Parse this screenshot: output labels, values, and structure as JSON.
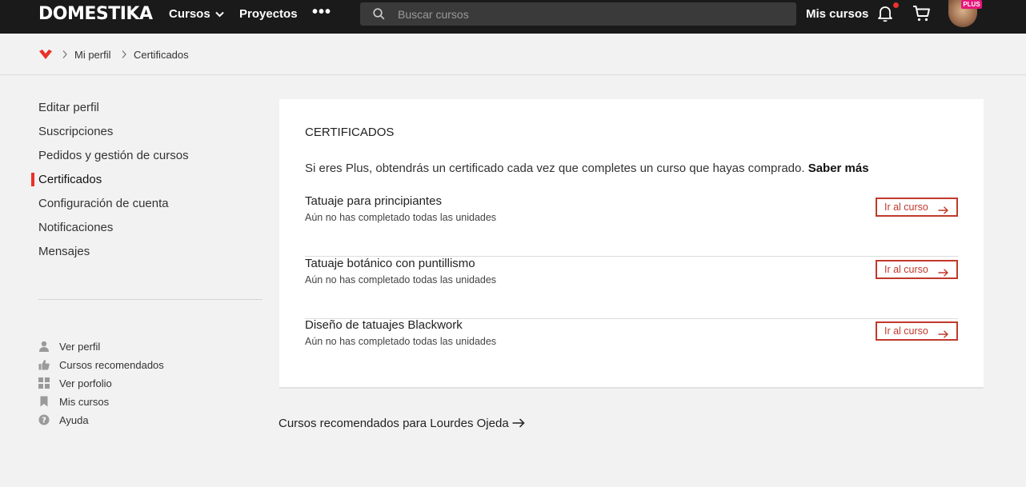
{
  "header": {
    "logo": "DOMESTIKA",
    "nav_cursos": "Cursos",
    "nav_proyectos": "Proyectos",
    "nav_more": "•••",
    "search_placeholder": "Buscar cursos",
    "mis_cursos": "Mis cursos",
    "plus_badge": "PLUS",
    "notification_color": "#e8322a"
  },
  "breadcrumb": {
    "items": [
      "Mi perfil",
      "Certificados"
    ]
  },
  "sidebar": {
    "items": [
      {
        "label": "Editar perfil"
      },
      {
        "label": "Suscripciones"
      },
      {
        "label": "Pedidos y gestión de cursos"
      },
      {
        "label": "Certificados",
        "active": true
      },
      {
        "label": "Configuración de cuenta"
      },
      {
        "label": "Notificaciones"
      },
      {
        "label": "Mensajes"
      }
    ],
    "links": [
      {
        "label": "Ver perfil",
        "icon": "user-icon"
      },
      {
        "label": "Cursos recomendados",
        "icon": "thumbs-up-icon"
      },
      {
        "label": "Ver porfolio",
        "icon": "grid-icon"
      },
      {
        "label": "Mis cursos",
        "icon": "bookmark-icon"
      },
      {
        "label": "Ayuda",
        "icon": "help-icon"
      }
    ]
  },
  "main": {
    "title": "CERTIFICADOS",
    "intro": "Si eres Plus, obtendrás un certificado cada vez que completes un curso que hayas comprado.",
    "intro_link": "Saber más",
    "courses": [
      {
        "name": "Tatuaje para principiantes",
        "status": "Aún no has completado todas las unidades",
        "button": "Ir al curso"
      },
      {
        "name": "Tatuaje botánico con puntillismo",
        "status": "Aún no has completado todas las unidades",
        "button": "Ir al curso"
      },
      {
        "name": "Diseño de tatuajes Blackwork",
        "status": "Aún no has completado todas las unidades",
        "button": "Ir al curso"
      }
    ],
    "recommended": "Cursos recomendados para Lourdes Ojeda"
  },
  "colors": {
    "accent": "#c0392b",
    "topbar": "#1a1a1a",
    "active_indicator": "#e8322a"
  }
}
